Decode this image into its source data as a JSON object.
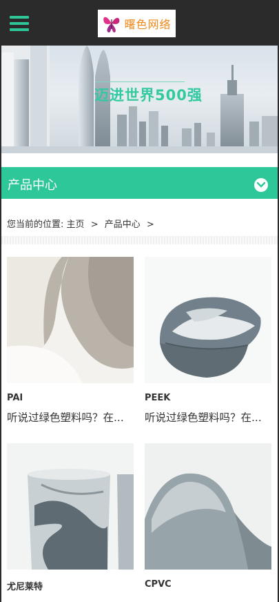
{
  "header": {
    "menu_icon": "hamburger-menu-icon",
    "logo_text": "曙色网络",
    "accent_color": "#2ec79a"
  },
  "banner": {
    "headline": "迈进世界500强"
  },
  "category": {
    "title": "产品中心",
    "toggle_icon": "chevron-down-circle-icon"
  },
  "breadcrumb": {
    "prefix": "您当前的位置:",
    "items": [
      "主页",
      "产品中心"
    ],
    "separator": ">"
  },
  "products": [
    {
      "name": "PAI",
      "desc": "听说过绿色塑料吗？在..."
    },
    {
      "name": "PEEK",
      "desc": "听说过绿色塑料吗？在..."
    },
    {
      "name": "尤尼莱特",
      "desc": ""
    },
    {
      "name": "CPVC",
      "desc": ""
    }
  ]
}
